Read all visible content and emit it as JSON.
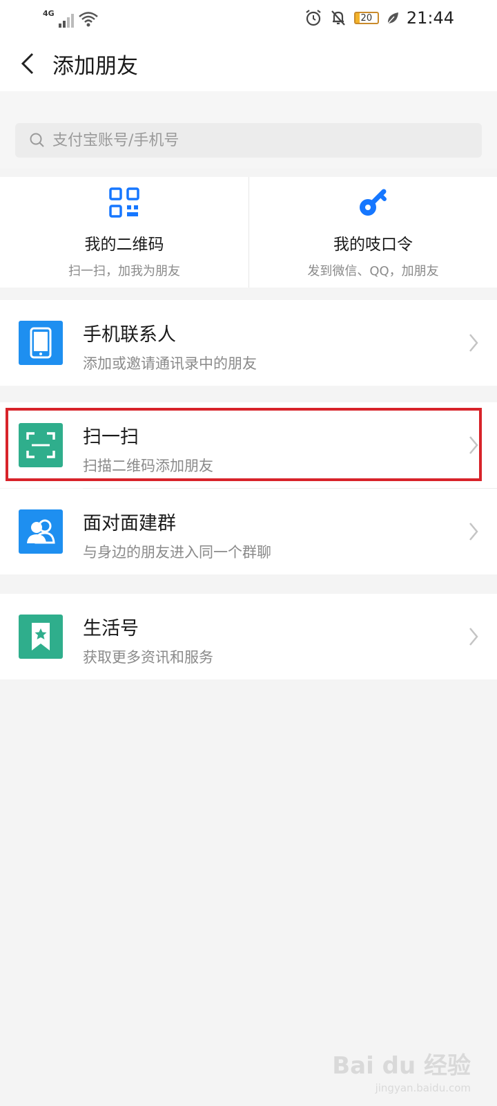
{
  "status_bar": {
    "network": "4G",
    "battery_level": "20",
    "time": "21:44",
    "icons": [
      "signal-icon",
      "wifi-icon",
      "alarm-icon",
      "mute-icon",
      "battery-icon",
      "leaf-icon"
    ]
  },
  "nav": {
    "title": "添加朋友",
    "back_icon": "chevron-left-icon"
  },
  "search": {
    "placeholder": "支付宝账号/手机号"
  },
  "quick_actions": [
    {
      "title": "我的二维码",
      "subtitle": "扫一扫，加我为朋友",
      "icon": "qr-code-icon",
      "color": "#1677ff"
    },
    {
      "title": "我的吱口令",
      "subtitle": "发到微信、QQ，加朋友",
      "icon": "key-icon",
      "color": "#1677ff"
    }
  ],
  "list": [
    {
      "title": "手机联系人",
      "subtitle": "添加或邀请通讯录中的朋友",
      "icon": "phone-icon",
      "color": "#1e8ff0"
    },
    {
      "title": "扫一扫",
      "subtitle": "扫描二维码添加朋友",
      "icon": "scan-icon",
      "color": "#2fae8c",
      "highlighted": true
    },
    {
      "title": "面对面建群",
      "subtitle": "与身边的朋友进入同一个群聊",
      "icon": "group-icon",
      "color": "#1e8ff0"
    },
    {
      "title": "生活号",
      "subtitle": "获取更多资讯和服务",
      "icon": "bookmark-star-icon",
      "color": "#2fae8c"
    }
  ],
  "watermark": {
    "main": "Bai du 经验",
    "sub": "jingyan.baidu.com"
  },
  "colors": {
    "highlight": "#d8232a",
    "accent_blue": "#1677ff",
    "accent_green": "#2fae8c"
  }
}
